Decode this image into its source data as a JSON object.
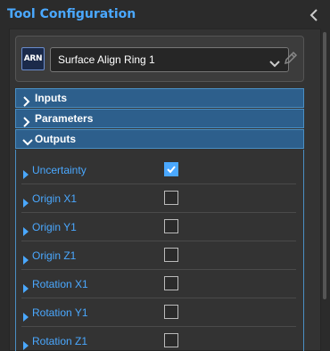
{
  "panel": {
    "title": "Tool Configuration",
    "collapse_icon": "chevron-left-icon"
  },
  "tool": {
    "badge": "ARN",
    "selected": "Surface Align Ring 1",
    "edit_icon": "pencil-icon"
  },
  "sections": [
    {
      "label": "Inputs",
      "expanded": false
    },
    {
      "label": "Parameters",
      "expanded": false
    },
    {
      "label": "Outputs",
      "expanded": true
    }
  ],
  "outputs": [
    {
      "label": "Uncertainty",
      "checked": true
    },
    {
      "label": "Origin X1",
      "checked": false
    },
    {
      "label": "Origin Y1",
      "checked": false
    },
    {
      "label": "Origin Z1",
      "checked": false
    },
    {
      "label": "Rotation X1",
      "checked": false
    },
    {
      "label": "Rotation Y1",
      "checked": false
    },
    {
      "label": "Rotation Z1",
      "checked": false
    }
  ],
  "colors": {
    "accent": "#4aa8ff",
    "section_bg": "#2d5f8c",
    "section_border": "#4a8fc4"
  }
}
